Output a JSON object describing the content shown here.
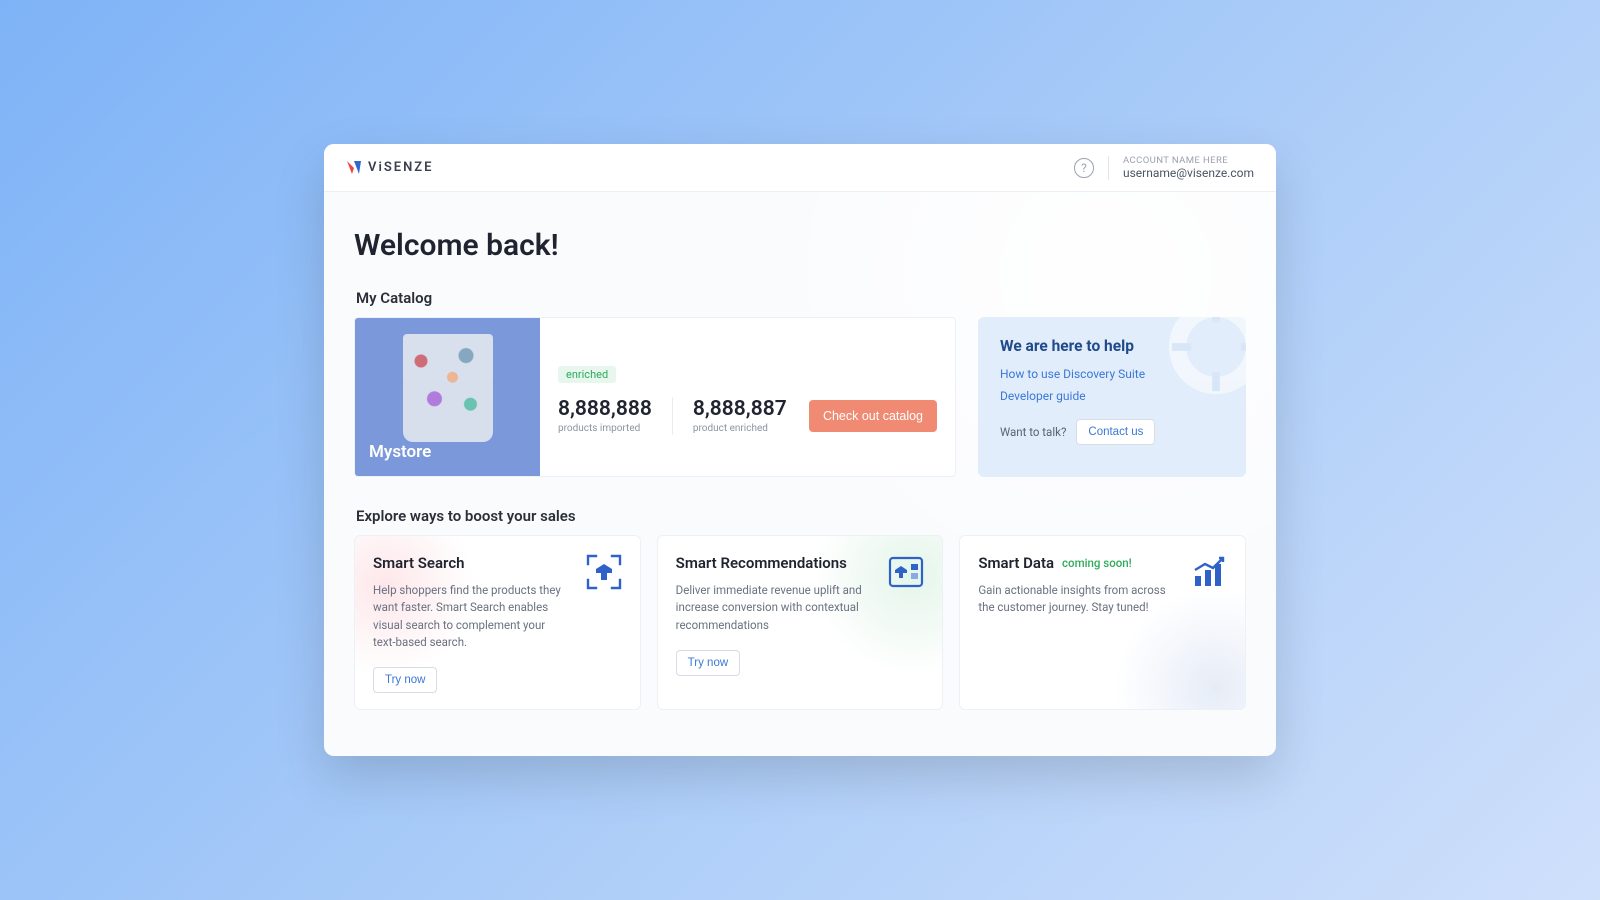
{
  "brand": {
    "name": "ViSENZE"
  },
  "header": {
    "account_label": "ACCOUNT NAME HERE",
    "email": "username@visenze.com"
  },
  "page": {
    "welcome": "Welcome back!",
    "catalog_section": "My Catalog",
    "explore_section": "Explore ways to boost your sales"
  },
  "catalog": {
    "store_name": "Mystore",
    "badge": "enriched",
    "imported": {
      "value": "8,888,888",
      "label": "products imported"
    },
    "enriched": {
      "value": "8,888,887",
      "label": "product enriched"
    },
    "cta": "Check out catalog"
  },
  "help": {
    "title": "We are here to help",
    "links": [
      "How to use Discovery Suite",
      "Developer guide"
    ],
    "talk_label": "Want to talk?",
    "contact_label": "Contact us"
  },
  "products": [
    {
      "title": "Smart Search",
      "desc": "Help shoppers find the products they want faster. Smart Search enables visual search to complement your text-based search.",
      "cta": "Try now"
    },
    {
      "title": "Smart Recommendations",
      "desc": "Deliver immediate revenue uplift and increase conversion with contextual recommendations",
      "cta": "Try now"
    },
    {
      "title": "Smart Data",
      "soon": "coming soon!",
      "desc": "Gain actionable insights from across the customer journey. Stay tuned!"
    }
  ]
}
